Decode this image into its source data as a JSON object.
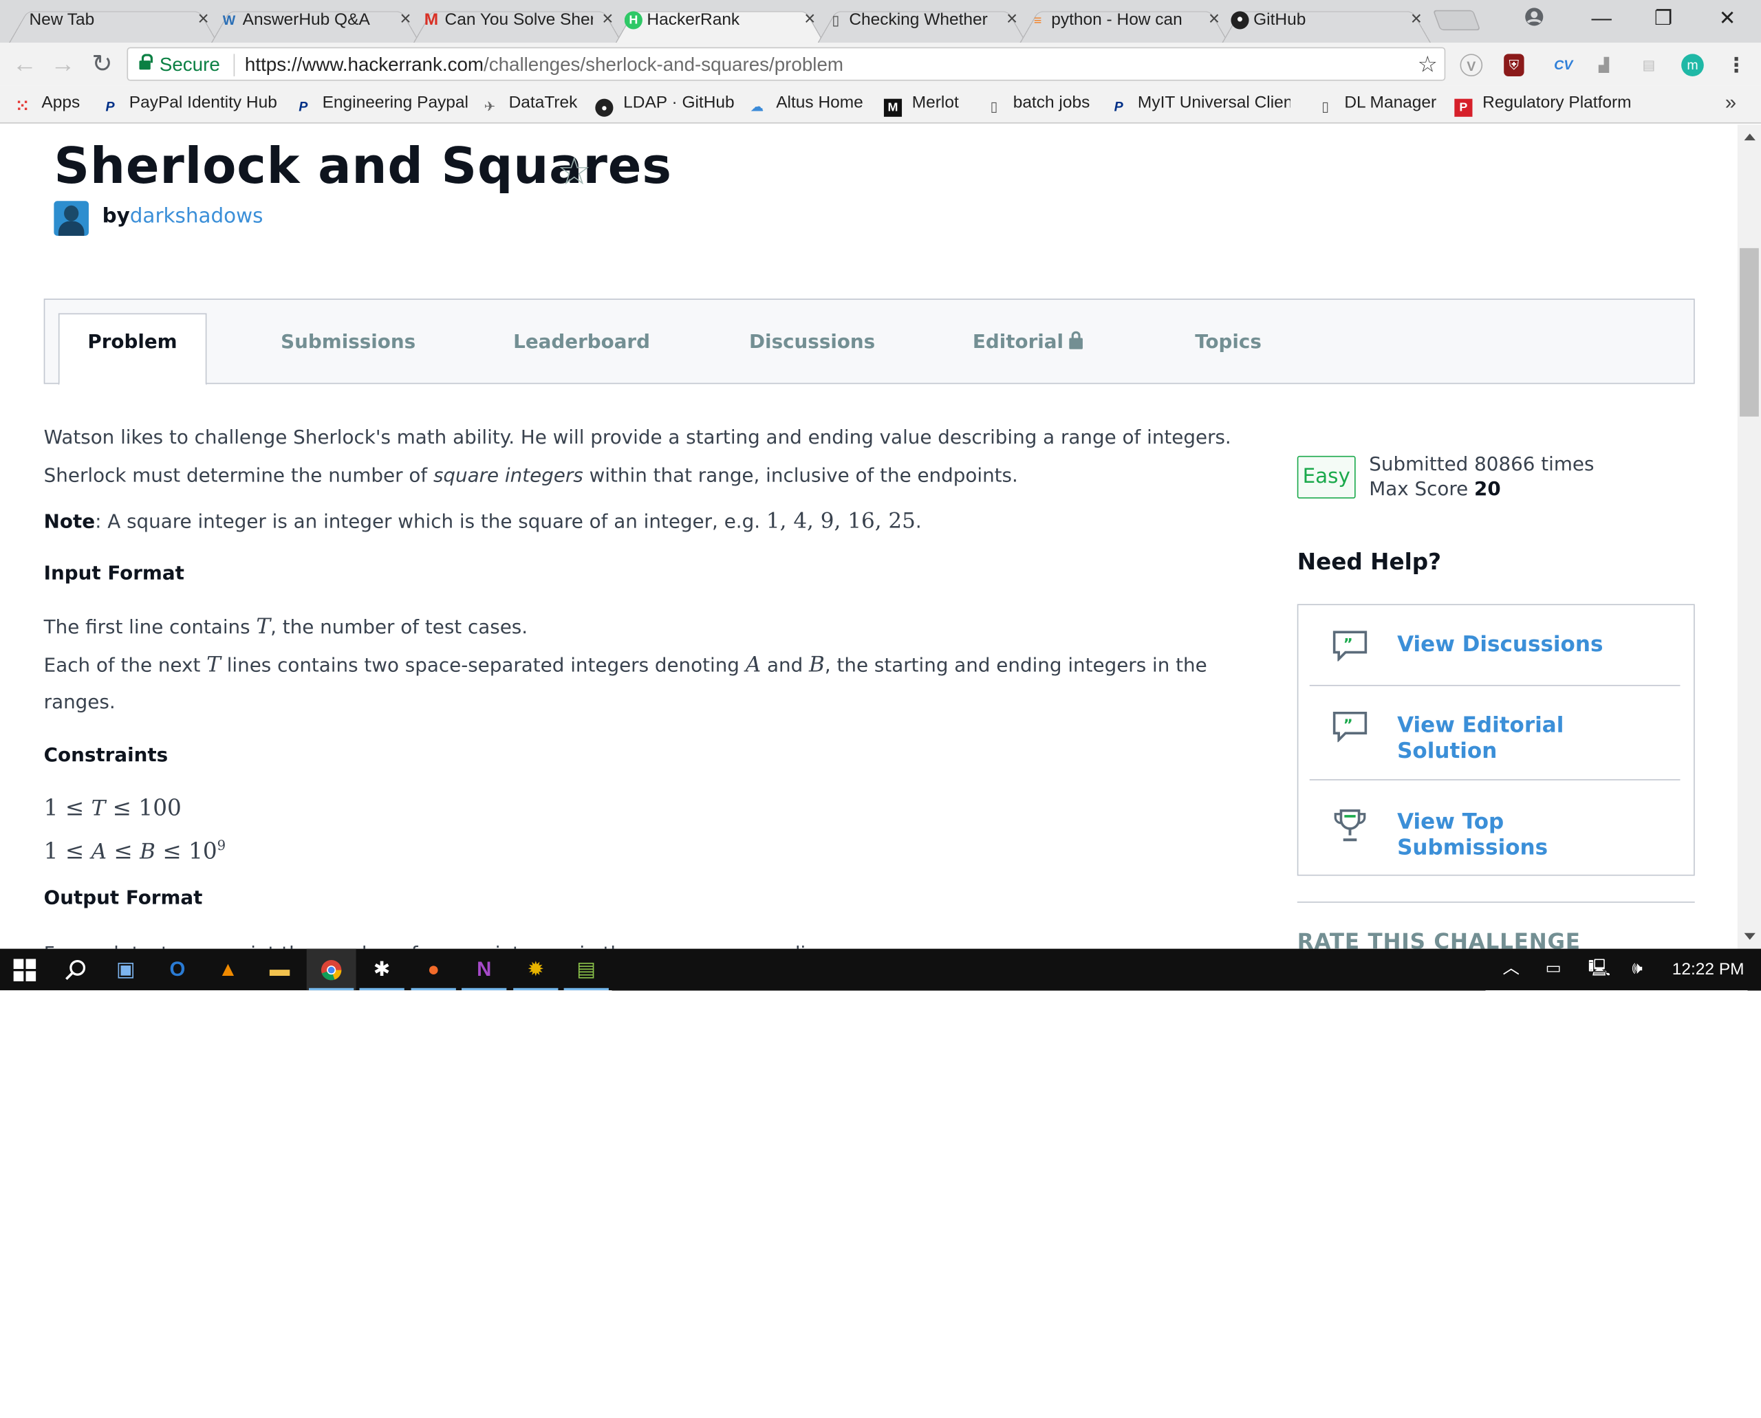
{
  "browser": {
    "tabs": [
      {
        "title": "New Tab",
        "icon": "blank-icon"
      },
      {
        "title": "AnswerHub Q&A",
        "icon": "answerhub-icon"
      },
      {
        "title": "Can You Solve Sherlock",
        "icon": "gmail-icon"
      },
      {
        "title": "HackerRank",
        "icon": "hackerrank-icon",
        "active": true
      },
      {
        "title": "Checking Whether",
        "icon": "document-icon"
      },
      {
        "title": "python - How can",
        "icon": "stackoverflow-icon"
      },
      {
        "title": "GitHub",
        "icon": "github-icon"
      }
    ],
    "close_glyph": "×",
    "address": {
      "secure_label": "Secure",
      "url_host": "https://www.hackerrank.com",
      "url_path": "/challenges/sherlock-and-squares/problem"
    },
    "bookmarks": [
      {
        "label": "Apps",
        "icon": "apps-grid-icon"
      },
      {
        "label": "PayPal Identity Hub",
        "icon": "paypal-icon"
      },
      {
        "label": "Engineering Paypal",
        "icon": "paypal-icon"
      },
      {
        "label": "DataTrek",
        "icon": "datatrek-icon"
      },
      {
        "label": "LDAP · GitHub",
        "icon": "github-icon"
      },
      {
        "label": "Altus Home",
        "icon": "altus-icon"
      },
      {
        "label": "Merlot",
        "icon": "merlot-icon"
      },
      {
        "label": "batch jobs",
        "icon": "document-icon"
      },
      {
        "label": "MyIT Universal Client",
        "icon": "paypal-icon"
      },
      {
        "label": "DL Manager",
        "icon": "document-icon"
      },
      {
        "label": "Regulatory Platform",
        "icon": "regulatory-icon"
      }
    ],
    "bookmarks_overflow": "»"
  },
  "page": {
    "title": "Sherlock and Squares",
    "by_label": "by",
    "author": "darkshadows",
    "tabs": [
      {
        "label": "Problem",
        "active": true
      },
      {
        "label": "Submissions"
      },
      {
        "label": "Leaderboard"
      },
      {
        "label": "Discussions"
      },
      {
        "label": "Editorial",
        "locked": true
      },
      {
        "label": "Topics"
      }
    ],
    "problem": {
      "intro_1": "Watson likes to challenge Sherlock's math ability. He will provide a starting and ending value describing a range of integers.",
      "intro_2a": "Sherlock must determine the number of ",
      "intro_2b": "square integers",
      "intro_2c": " within that range, inclusive of the endpoints.",
      "note_label": "Note",
      "note_text": ": A square integer is an integer which is the square of an integer, e.g. ",
      "note_math": "1, 4, 9, 16, 25",
      "note_end": ".",
      "input_heading": "Input Format",
      "input_1a": "The first line contains ",
      "var_T": "T",
      "input_1b": ", the number of test cases.",
      "input_2a": "Each of the next ",
      "input_2b": " lines contains two space-separated integers denoting ",
      "var_A": "A",
      "and_word": " and ",
      "var_B": "B",
      "input_2c": ", the starting and ending integers in the",
      "input_3": "ranges.",
      "constraints_heading": "Constraints",
      "c1_left": "1 ≤ ",
      "c1_right": " ≤ 100",
      "c2_left": "1 ≤ ",
      "c2_mid": " ≤ ",
      "c2_right": " ≤ 10",
      "c2_exp": "9",
      "output_heading": "Output Format",
      "output_1": "For each test case, print the number of square integers in the range on a new line."
    },
    "sidebar": {
      "difficulty": "Easy",
      "submitted": "Submitted 80866 times",
      "max_score_label": "Max Score ",
      "max_score": "20",
      "need_help": "Need Help?",
      "help_items": [
        {
          "label_1": "View Discussions",
          "label_2": "",
          "icon": "quote-bubble-icon"
        },
        {
          "label_1": "View Editorial",
          "label_2": "Solution",
          "icon": "quote-bubble-icon"
        },
        {
          "label_1": "View Top",
          "label_2": "Submissions",
          "icon": "trophy-icon"
        }
      ],
      "rate": "RATE THIS CHALLENGE"
    }
  },
  "taskbar": {
    "clock": "12:22 PM"
  },
  "colors": {
    "link_blue": "#3b8fd8",
    "easy_green": "#1ba94c",
    "title_dark": "#0e141e",
    "muted_tab": "#738f93"
  }
}
